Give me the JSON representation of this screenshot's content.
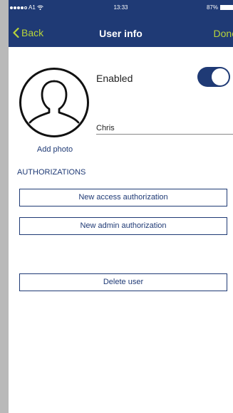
{
  "status_bar": {
    "carrier": "A1",
    "time": "13:33",
    "battery": "87%"
  },
  "nav": {
    "back_label": "Back",
    "title": "User info",
    "done_label": "Done"
  },
  "profile": {
    "add_photo_label": "Add photo",
    "enabled_label": "Enabled",
    "enabled": true,
    "name_value": "Chris"
  },
  "authorizations": {
    "section_title": "AUTHORIZATIONS",
    "new_access_label": "New access authorization",
    "new_admin_label": "New admin authorization"
  },
  "actions": {
    "delete_label": "Delete user"
  },
  "colors": {
    "nav_background": "#1f3a75",
    "accent": "#b8d43a",
    "background": "#ffffff"
  }
}
